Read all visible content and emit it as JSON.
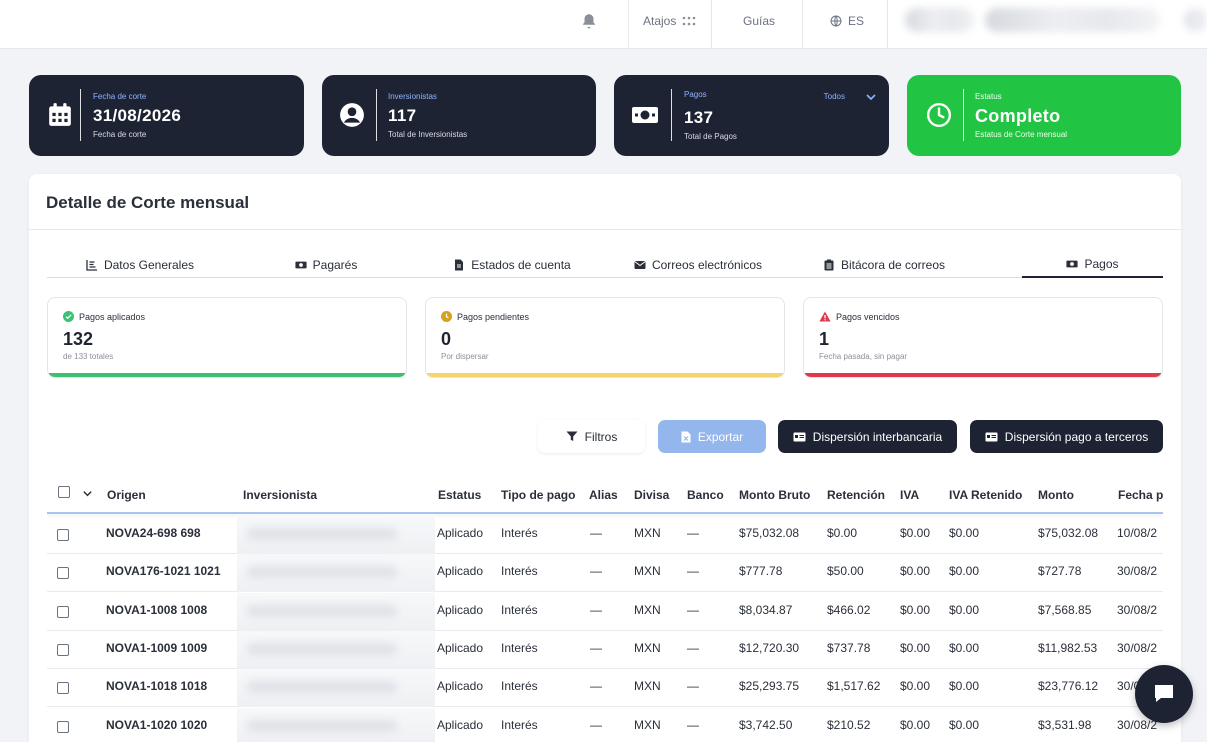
{
  "topbar": {
    "shortcuts_label": "Atajos",
    "guides_label": "Guías",
    "language_label": "ES"
  },
  "cards": [
    {
      "label": "Fecha de corte",
      "value": "31/08/2026",
      "sub": "Fecha de corte",
      "icon": "calendar-icon"
    },
    {
      "label": "Inversionistas",
      "value": "117",
      "sub": "Total de Inversionistas",
      "icon": "user-circle-icon"
    },
    {
      "label": "Pagos",
      "value": "137",
      "sub": "Total de Pagos",
      "filter": "Todos",
      "icon": "money-icon"
    },
    {
      "label": "Estatus",
      "value": "Completo",
      "sub": "Estatus de Corte mensual",
      "icon": "clock-icon",
      "color": "#22c543"
    }
  ],
  "panel": {
    "title": "Detalle de Corte mensual",
    "tabs": [
      {
        "label": "Datos Generales",
        "icon": "chart-icon"
      },
      {
        "label": "Pagarés",
        "icon": "money-icon"
      },
      {
        "label": "Estados de cuenta",
        "icon": "file-icon"
      },
      {
        "label": "Correos electrónicos",
        "icon": "envelope-icon"
      },
      {
        "label": "Bitácora de correos",
        "icon": "clipboard-icon"
      },
      {
        "label": "Pagos",
        "icon": "money-icon",
        "active": true
      }
    ],
    "stats": [
      {
        "title": "Pagos aplicados",
        "value": "132",
        "caption": "de 133 totales",
        "color": "#3cc073"
      },
      {
        "title": "Pagos pendientes",
        "value": "0",
        "caption": "Por dispersar",
        "color": "#f5d56b"
      },
      {
        "title": "Pagos vencidos",
        "value": "1",
        "caption": "Fecha pasada, sin pagar",
        "color": "#e0394a"
      }
    ],
    "buttons": {
      "filters": "Filtros",
      "export": "Exportar",
      "interbank": "Dispersión interbancaria",
      "third_party": "Dispersión pago a terceros"
    }
  },
  "table": {
    "columns": [
      "Origen",
      "Inversionista",
      "Estatus",
      "Tipo de pago",
      "Alias",
      "Divisa",
      "Banco",
      "Monto Bruto",
      "Retención",
      "IVA",
      "IVA Retenido",
      "Monto",
      "Fecha pr"
    ],
    "rows": [
      {
        "origen": "NOVA24-698 698",
        "estatus": "Aplicado",
        "tipo": "Interés",
        "alias": "—",
        "divisa": "MXN",
        "banco": "—",
        "bruto": "$75,032.08",
        "retencion": "$0.00",
        "iva": "$0.00",
        "iva_ret": "$0.00",
        "monto": "$75,032.08",
        "fecha": "10/08/2"
      },
      {
        "origen": "NOVA176-1021 1021",
        "estatus": "Aplicado",
        "tipo": "Interés",
        "alias": "—",
        "divisa": "MXN",
        "banco": "—",
        "bruto": "$777.78",
        "retencion": "$50.00",
        "iva": "$0.00",
        "iva_ret": "$0.00",
        "monto": "$727.78",
        "fecha": "30/08/2"
      },
      {
        "origen": "NOVA1-1008 1008",
        "estatus": "Aplicado",
        "tipo": "Interés",
        "alias": "—",
        "divisa": "MXN",
        "banco": "—",
        "bruto": "$8,034.87",
        "retencion": "$466.02",
        "iva": "$0.00",
        "iva_ret": "$0.00",
        "monto": "$7,568.85",
        "fecha": "30/08/2"
      },
      {
        "origen": "NOVA1-1009 1009",
        "estatus": "Aplicado",
        "tipo": "Interés",
        "alias": "—",
        "divisa": "MXN",
        "banco": "—",
        "bruto": "$12,720.30",
        "retencion": "$737.78",
        "iva": "$0.00",
        "iva_ret": "$0.00",
        "monto": "$11,982.53",
        "fecha": "30/08/2"
      },
      {
        "origen": "NOVA1-1018 1018",
        "estatus": "Aplicado",
        "tipo": "Interés",
        "alias": "—",
        "divisa": "MXN",
        "banco": "—",
        "bruto": "$25,293.75",
        "retencion": "$1,517.62",
        "iva": "$0.00",
        "iva_ret": "$0.00",
        "monto": "$23,776.12",
        "fecha": "30/0"
      },
      {
        "origen": "NOVA1-1020 1020",
        "estatus": "Aplicado",
        "tipo": "Interés",
        "alias": "—",
        "divisa": "MXN",
        "banco": "—",
        "bruto": "$3,742.50",
        "retencion": "$210.52",
        "iva": "$0.00",
        "iva_ret": "$0.00",
        "monto": "$3,531.98",
        "fecha": "30/08/2"
      }
    ]
  }
}
